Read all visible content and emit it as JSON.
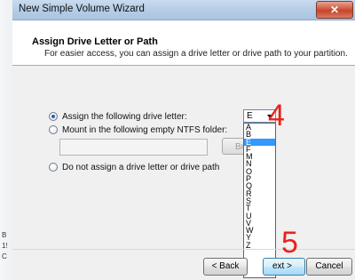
{
  "window": {
    "title": "New Simple Volume Wizard",
    "close_glyph": "✕"
  },
  "background_fragments": [
    "B",
    "1!",
    "C"
  ],
  "header": {
    "title": "Assign Drive Letter or Path",
    "subtitle": "For easier access, you can assign a drive letter or drive path to your partition."
  },
  "options": {
    "assign_letter": {
      "label": "Assign the following drive letter:",
      "checked": true
    },
    "mount_folder": {
      "label": "Mount in the following empty NTFS folder:",
      "checked": false
    },
    "no_assign": {
      "label": "Do not assign a drive letter or drive path",
      "checked": false
    }
  },
  "drive_letter": {
    "selected": "E",
    "options": [
      "A",
      "B",
      "E",
      "F",
      "M",
      "N",
      "O",
      "P",
      "Q",
      "R",
      "S",
      "T",
      "U",
      "V",
      "W",
      "Y",
      "Z"
    ],
    "highlighted_index": 2
  },
  "folder_path": {
    "value": "",
    "browse_label": "Br..."
  },
  "buttons": {
    "back": "< Back",
    "next": "ext >",
    "cancel": "Cancel"
  },
  "annotations": {
    "step4": "4",
    "step5": "5"
  },
  "colors": {
    "annotation": "#e8231a",
    "selection": "#3399ff"
  }
}
